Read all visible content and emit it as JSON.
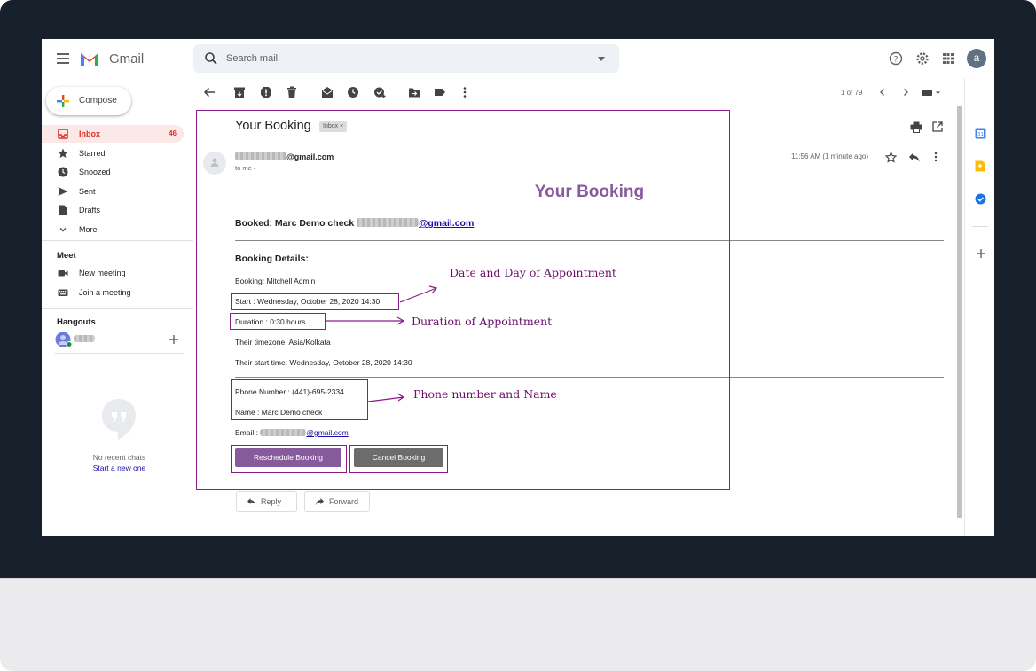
{
  "app": {
    "name": "Gmail"
  },
  "header": {
    "search_placeholder": "Search mail",
    "avatar_letter": "a"
  },
  "sidebar": {
    "compose_label": "Compose",
    "items": [
      {
        "label": "Inbox",
        "count": "46",
        "icon": "inbox-icon",
        "active": true
      },
      {
        "label": "Starred",
        "icon": "star-icon"
      },
      {
        "label": "Snoozed",
        "icon": "clock-icon"
      },
      {
        "label": "Sent",
        "icon": "send-icon"
      },
      {
        "label": "Drafts",
        "icon": "draft-icon"
      },
      {
        "label": "More",
        "icon": "chevron-down-icon"
      }
    ],
    "meet": {
      "title": "Meet",
      "items": [
        {
          "label": "New meeting",
          "icon": "video-icon"
        },
        {
          "label": "Join a meeting",
          "icon": "keyboard-icon"
        }
      ]
    },
    "hangouts": {
      "title": "Hangouts",
      "no_recent": "No recent chats",
      "start_new": "Start a new one"
    }
  },
  "toolbar": {
    "pager": "1 of 79"
  },
  "message": {
    "subject": "Your Booking",
    "label_chip": "Inbox",
    "chip_close": "×",
    "sender_suffix": "@gmail.com",
    "to_me": "to me",
    "timestamp": "11:56 AM (1 minute ago)",
    "body": {
      "heading": "Your Booking",
      "booked_prefix": "Booked: Marc Demo check",
      "booked_email_suffix": "@gmail.com",
      "details_title": "Booking Details:",
      "booking": "Booking: Mitchell Admin",
      "start": "Start : Wednesday, October 28, 2020 14:30",
      "duration": "Duration : 0:30 hours",
      "timezone": "Their timezone: Asia/Kolkata",
      "start_time": "Their start time: Wednesday, October 28, 2020 14:30",
      "phone": "Phone Number : (441)-695-2334",
      "name": "Name : Marc Demo check",
      "email_prefix": "Email :",
      "email_suffix": "@gmail.com",
      "reschedule_label": "Reschedule Booking",
      "cancel_label": "Cancel Booking"
    },
    "reply_label": "Reply",
    "forward_label": "Forward"
  },
  "annotations": {
    "date_day": "Date and Day of Appointment",
    "duration": "Duration of Appointment",
    "phone_name": "Phone number and Name"
  },
  "colors": {
    "accent_purple": "#875a9c",
    "annotation": "#8b1a8b",
    "gmail_red": "#d93025"
  }
}
